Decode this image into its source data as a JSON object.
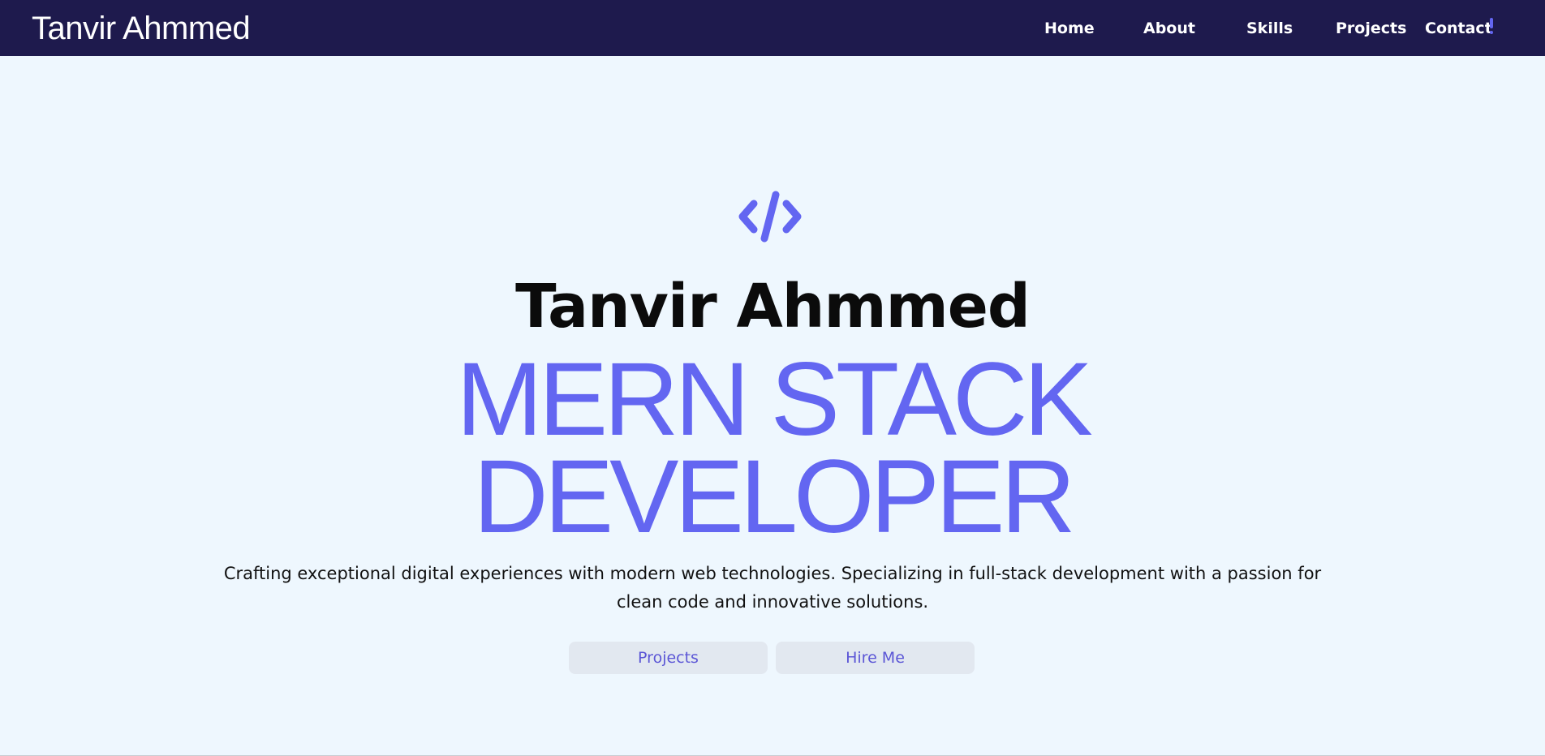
{
  "navbar": {
    "brand": "Tanvir Ahmmed",
    "links": [
      "Home",
      "About",
      "Skills",
      "Projects",
      "Contact"
    ],
    "background_color": "#1e1a4d",
    "badge_icon": "exclamation-icon"
  },
  "hero": {
    "icon": "code-icon",
    "name": "Tanvir Ahmmed",
    "role_line1": "MERN STACK",
    "role_line2": "DEVELOPER",
    "description": "Crafting exceptional digital experiences with modern web technologies. Specializing in full-stack development with a passion for clean code and innovative solutions.",
    "buttons": {
      "projects": "Projects",
      "hire": "Hire Me"
    },
    "accent_color": "#6366f1",
    "background_color": "#eef7fe"
  }
}
